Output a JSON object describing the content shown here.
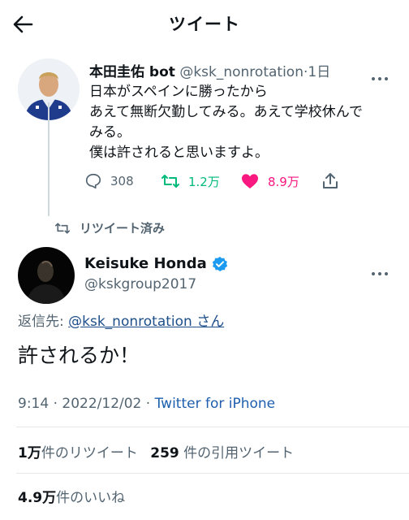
{
  "header": {
    "title": "ツイート"
  },
  "quoted_tweet": {
    "display_name": "本田圭佑 bot",
    "handle": "@ksk_nonrotation",
    "time": "·1日",
    "lines": [
      "日本がスペインに勝ったから",
      "あえて無断欠勤してみる。あえて学校休んで",
      "みる。",
      "僕は許されると思いますよ。"
    ],
    "replies": "308",
    "retweets": "1.2万",
    "likes": "8.9万"
  },
  "retweet_indicator": {
    "label": "リツイート済み"
  },
  "main_tweet": {
    "display_name": "Keisuke Honda",
    "handle": "@kskgroup2017",
    "reply_prefix": "返信先:",
    "reply_target": "@ksk_nonrotation",
    "reply_suffix": "さん",
    "text": "許されるか！",
    "time_date": "9:14 · 2022/12/02 · ",
    "source": "Twitter for iPhone"
  },
  "stats": {
    "retweets_count": "1万",
    "retweets_label": "件のリツイート",
    "quotes_count": "259",
    "quotes_label": "件の引用ツイート",
    "likes_count": "4.9万",
    "likes_label": "件のいいね"
  },
  "colors": {
    "like": "#f91880",
    "retweet": "#00ba7c",
    "verified": "#1d9bf0",
    "link": "#1d4e89"
  }
}
